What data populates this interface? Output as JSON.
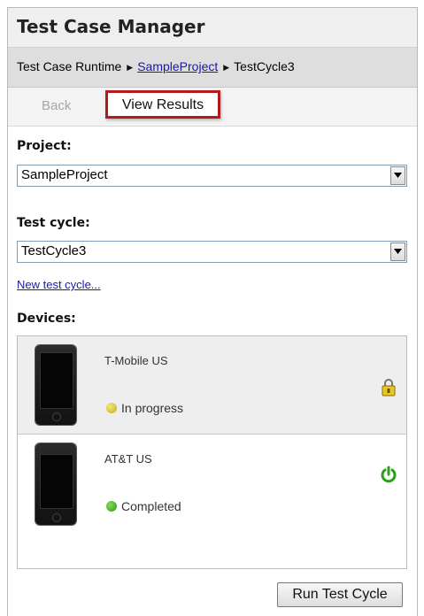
{
  "app": {
    "title": "Test Case Manager"
  },
  "breadcrumb": {
    "items": [
      {
        "label": "Test Case Runtime",
        "link": false
      },
      {
        "label": "SampleProject",
        "link": true
      },
      {
        "label": "TestCycle3",
        "link": false
      }
    ]
  },
  "toolbar": {
    "back_label": "Back",
    "view_results_label": "View Results"
  },
  "project": {
    "label": "Project:",
    "value": "SampleProject"
  },
  "test_cycle": {
    "label": "Test cycle:",
    "value": "TestCycle3",
    "new_link": "New test cycle..."
  },
  "devices": {
    "label": "Devices:",
    "items": [
      {
        "name": "T-Mobile US",
        "status": "In progress",
        "status_color": "#d6c22a",
        "icon": "lock-icon",
        "selected": true
      },
      {
        "name": "AT&T US",
        "status": "Completed",
        "status_color": "#3aa31a",
        "icon": "power-icon",
        "selected": false
      }
    ]
  },
  "actions": {
    "run_label": "Run Test Cycle"
  },
  "colors": {
    "highlight_border": "#b31b1b",
    "link": "#1a1aa8",
    "power": "#2aa01a"
  }
}
